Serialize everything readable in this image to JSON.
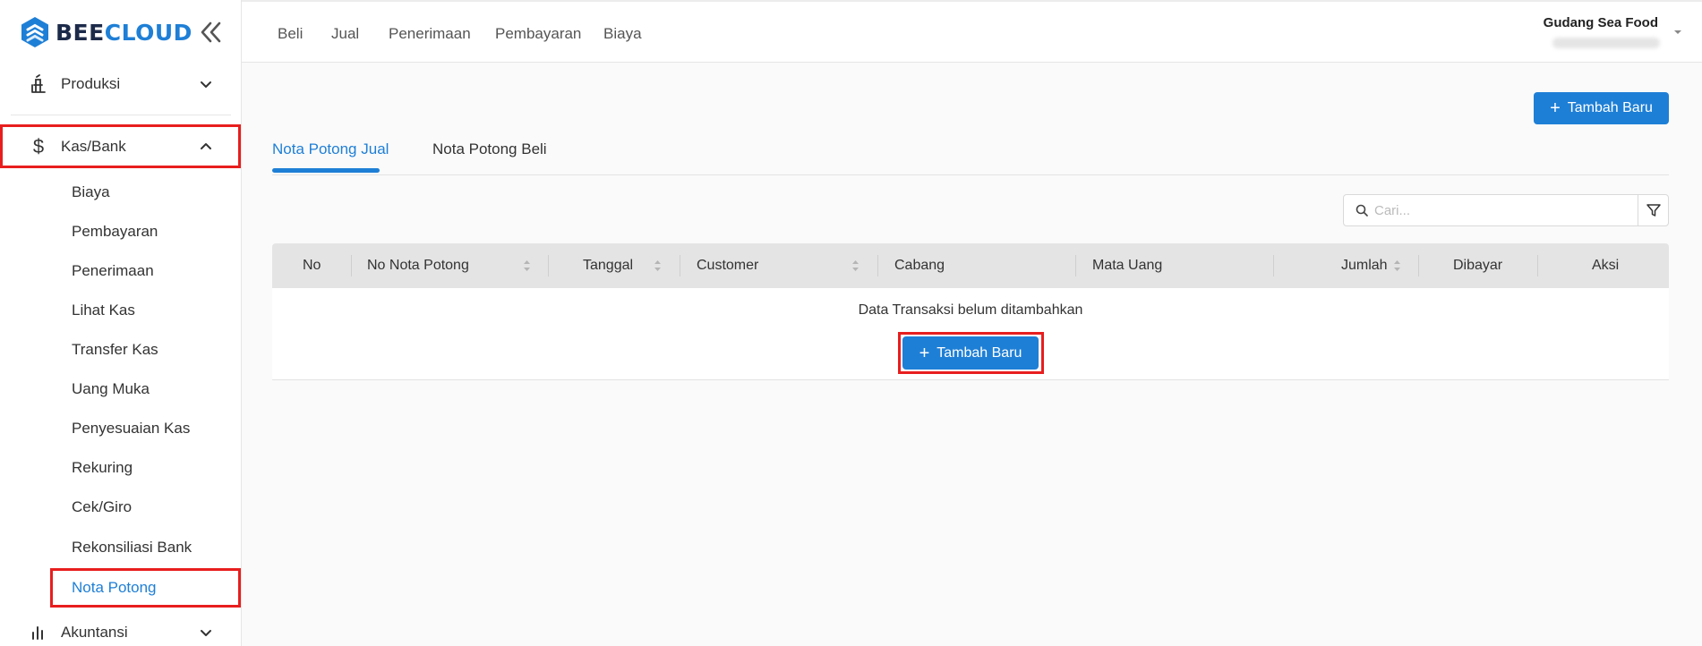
{
  "logo": {
    "part1": "BEE",
    "part2": "CLOUD"
  },
  "sidebar": {
    "groups": [
      {
        "label": "Produksi",
        "icon": "factory-icon",
        "expanded": false
      },
      {
        "label": "Kas/Bank",
        "icon": "dollar-icon",
        "expanded": true
      },
      {
        "label": "Akuntansi",
        "icon": "bar-chart-icon",
        "expanded": false
      }
    ],
    "kas_bank_items": [
      {
        "label": "Biaya"
      },
      {
        "label": "Pembayaran"
      },
      {
        "label": "Penerimaan"
      },
      {
        "label": "Lihat Kas"
      },
      {
        "label": "Transfer Kas"
      },
      {
        "label": "Uang Muka"
      },
      {
        "label": "Penyesuaian Kas"
      },
      {
        "label": "Rekuring"
      },
      {
        "label": "Cek/Giro"
      },
      {
        "label": "Rekonsiliasi Bank"
      },
      {
        "label": "Nota Potong",
        "active": true
      }
    ]
  },
  "topbar": {
    "nav": [
      "Beli",
      "Jual",
      "Penerimaan",
      "Pembayaran",
      "Biaya"
    ],
    "company": "Gudang Sea Food"
  },
  "actions": {
    "add_label": "Tambah Baru"
  },
  "tabs": [
    {
      "label": "Nota Potong Jual",
      "active": true
    },
    {
      "label": "Nota Potong Beli",
      "active": false
    }
  ],
  "search": {
    "placeholder": "Cari..."
  },
  "table": {
    "columns": [
      "No",
      "No Nota Potong",
      "Tanggal",
      "Customer",
      "Cabang",
      "Mata Uang",
      "Jumlah",
      "Dibayar",
      "Aksi"
    ],
    "empty_text": "Data Transaksi belum ditambahkan",
    "empty_add_label": "Tambah Baru"
  },
  "colors": {
    "accent": "#1e7fd6",
    "highlight": "#e81e1e",
    "brand_dark": "#1c2a4a"
  }
}
